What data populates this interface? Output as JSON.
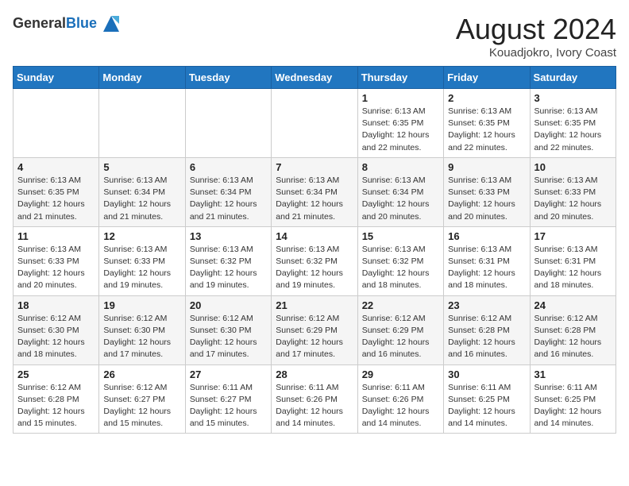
{
  "header": {
    "logo_line1": "General",
    "logo_line2": "Blue",
    "main_title": "August 2024",
    "sub_title": "Kouadjokro, Ivory Coast"
  },
  "days_of_week": [
    "Sunday",
    "Monday",
    "Tuesday",
    "Wednesday",
    "Thursday",
    "Friday",
    "Saturday"
  ],
  "weeks": [
    [
      {
        "day": "",
        "info": ""
      },
      {
        "day": "",
        "info": ""
      },
      {
        "day": "",
        "info": ""
      },
      {
        "day": "",
        "info": ""
      },
      {
        "day": "1",
        "info": "Sunrise: 6:13 AM\nSunset: 6:35 PM\nDaylight: 12 hours\nand 22 minutes."
      },
      {
        "day": "2",
        "info": "Sunrise: 6:13 AM\nSunset: 6:35 PM\nDaylight: 12 hours\nand 22 minutes."
      },
      {
        "day": "3",
        "info": "Sunrise: 6:13 AM\nSunset: 6:35 PM\nDaylight: 12 hours\nand 22 minutes."
      }
    ],
    [
      {
        "day": "4",
        "info": "Sunrise: 6:13 AM\nSunset: 6:35 PM\nDaylight: 12 hours\nand 21 minutes."
      },
      {
        "day": "5",
        "info": "Sunrise: 6:13 AM\nSunset: 6:34 PM\nDaylight: 12 hours\nand 21 minutes."
      },
      {
        "day": "6",
        "info": "Sunrise: 6:13 AM\nSunset: 6:34 PM\nDaylight: 12 hours\nand 21 minutes."
      },
      {
        "day": "7",
        "info": "Sunrise: 6:13 AM\nSunset: 6:34 PM\nDaylight: 12 hours\nand 21 minutes."
      },
      {
        "day": "8",
        "info": "Sunrise: 6:13 AM\nSunset: 6:34 PM\nDaylight: 12 hours\nand 20 minutes."
      },
      {
        "day": "9",
        "info": "Sunrise: 6:13 AM\nSunset: 6:33 PM\nDaylight: 12 hours\nand 20 minutes."
      },
      {
        "day": "10",
        "info": "Sunrise: 6:13 AM\nSunset: 6:33 PM\nDaylight: 12 hours\nand 20 minutes."
      }
    ],
    [
      {
        "day": "11",
        "info": "Sunrise: 6:13 AM\nSunset: 6:33 PM\nDaylight: 12 hours\nand 20 minutes."
      },
      {
        "day": "12",
        "info": "Sunrise: 6:13 AM\nSunset: 6:33 PM\nDaylight: 12 hours\nand 19 minutes."
      },
      {
        "day": "13",
        "info": "Sunrise: 6:13 AM\nSunset: 6:32 PM\nDaylight: 12 hours\nand 19 minutes."
      },
      {
        "day": "14",
        "info": "Sunrise: 6:13 AM\nSunset: 6:32 PM\nDaylight: 12 hours\nand 19 minutes."
      },
      {
        "day": "15",
        "info": "Sunrise: 6:13 AM\nSunset: 6:32 PM\nDaylight: 12 hours\nand 18 minutes."
      },
      {
        "day": "16",
        "info": "Sunrise: 6:13 AM\nSunset: 6:31 PM\nDaylight: 12 hours\nand 18 minutes."
      },
      {
        "day": "17",
        "info": "Sunrise: 6:13 AM\nSunset: 6:31 PM\nDaylight: 12 hours\nand 18 minutes."
      }
    ],
    [
      {
        "day": "18",
        "info": "Sunrise: 6:12 AM\nSunset: 6:30 PM\nDaylight: 12 hours\nand 18 minutes."
      },
      {
        "day": "19",
        "info": "Sunrise: 6:12 AM\nSunset: 6:30 PM\nDaylight: 12 hours\nand 17 minutes."
      },
      {
        "day": "20",
        "info": "Sunrise: 6:12 AM\nSunset: 6:30 PM\nDaylight: 12 hours\nand 17 minutes."
      },
      {
        "day": "21",
        "info": "Sunrise: 6:12 AM\nSunset: 6:29 PM\nDaylight: 12 hours\nand 17 minutes."
      },
      {
        "day": "22",
        "info": "Sunrise: 6:12 AM\nSunset: 6:29 PM\nDaylight: 12 hours\nand 16 minutes."
      },
      {
        "day": "23",
        "info": "Sunrise: 6:12 AM\nSunset: 6:28 PM\nDaylight: 12 hours\nand 16 minutes."
      },
      {
        "day": "24",
        "info": "Sunrise: 6:12 AM\nSunset: 6:28 PM\nDaylight: 12 hours\nand 16 minutes."
      }
    ],
    [
      {
        "day": "25",
        "info": "Sunrise: 6:12 AM\nSunset: 6:28 PM\nDaylight: 12 hours\nand 15 minutes."
      },
      {
        "day": "26",
        "info": "Sunrise: 6:12 AM\nSunset: 6:27 PM\nDaylight: 12 hours\nand 15 minutes."
      },
      {
        "day": "27",
        "info": "Sunrise: 6:11 AM\nSunset: 6:27 PM\nDaylight: 12 hours\nand 15 minutes."
      },
      {
        "day": "28",
        "info": "Sunrise: 6:11 AM\nSunset: 6:26 PM\nDaylight: 12 hours\nand 14 minutes."
      },
      {
        "day": "29",
        "info": "Sunrise: 6:11 AM\nSunset: 6:26 PM\nDaylight: 12 hours\nand 14 minutes."
      },
      {
        "day": "30",
        "info": "Sunrise: 6:11 AM\nSunset: 6:25 PM\nDaylight: 12 hours\nand 14 minutes."
      },
      {
        "day": "31",
        "info": "Sunrise: 6:11 AM\nSunset: 6:25 PM\nDaylight: 12 hours\nand 14 minutes."
      }
    ]
  ]
}
